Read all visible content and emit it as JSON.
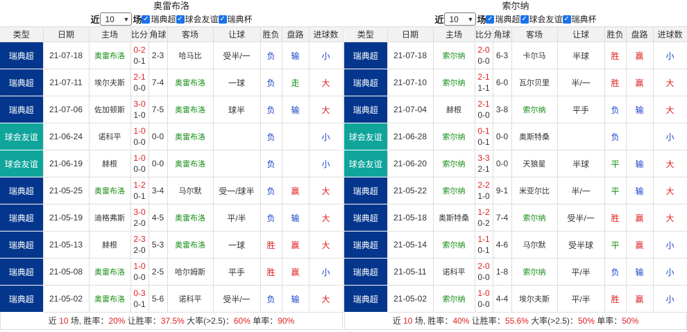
{
  "colors": {
    "league_bg": "#03368c",
    "cup_bg": "#0fa59b",
    "win": "#e02020",
    "home_team": "#138c13",
    "loss": "#1a42c9"
  },
  "panels": [
    {
      "title": "奥雷布洛",
      "filter": {
        "prefix": "近",
        "count": "10",
        "suffix": "场",
        "options": [
          "瑞典超",
          "球会友谊",
          "瑞典杯"
        ]
      },
      "headers": [
        "类型",
        "日期",
        "主场",
        "比分",
        "角球",
        "客场",
        "让球",
        "胜负",
        "盘路",
        "进球数"
      ],
      "rows": [
        {
          "type": "瑞典超",
          "cup": false,
          "date": "21-07-18",
          "home": "奥雷布洛",
          "home_hl": true,
          "score_ft": "0-2",
          "score_ht": "0-1",
          "corner": "2-3",
          "away": "哈马比",
          "away_hl": false,
          "handicap": "受半/一",
          "result": "负",
          "result_c": "blue",
          "pan": "输",
          "pan_c": "blue",
          "goals": "小",
          "goals_c": "blue"
        },
        {
          "type": "瑞典超",
          "cup": false,
          "date": "21-07-11",
          "home": "埃尔夫斯",
          "home_hl": false,
          "score_ft": "2-1",
          "score_ht": "0-0",
          "corner": "7-4",
          "away": "奥雷布洛",
          "away_hl": true,
          "handicap": "一球",
          "result": "负",
          "result_c": "blue",
          "pan": "走",
          "pan_c": "green",
          "goals": "大",
          "goals_c": "red"
        },
        {
          "type": "瑞典超",
          "cup": false,
          "date": "21-07-06",
          "home": "佐加顿斯",
          "home_hl": false,
          "score_ft": "3-0",
          "score_ht": "1-0",
          "corner": "7-5",
          "away": "奥雷布洛",
          "away_hl": true,
          "handicap": "球半",
          "result": "负",
          "result_c": "blue",
          "pan": "输",
          "pan_c": "blue",
          "goals": "大",
          "goals_c": "red"
        },
        {
          "type": "球会友谊",
          "cup": true,
          "date": "21-06-24",
          "home": "诺科平",
          "home_hl": false,
          "score_ft": "1-0",
          "score_ht": "0-0",
          "corner": "0-0",
          "away": "奥雷布洛",
          "away_hl": true,
          "handicap": "",
          "result": "负",
          "result_c": "blue",
          "pan": "",
          "pan_c": "blue",
          "goals": "小",
          "goals_c": "blue"
        },
        {
          "type": "球会友谊",
          "cup": true,
          "date": "21-06-19",
          "home": "赫根",
          "home_hl": false,
          "score_ft": "1-0",
          "score_ht": "0-0",
          "corner": "0-0",
          "away": "奥雷布洛",
          "away_hl": true,
          "handicap": "",
          "result": "负",
          "result_c": "blue",
          "pan": "",
          "pan_c": "blue",
          "goals": "小",
          "goals_c": "blue"
        },
        {
          "type": "瑞典超",
          "cup": false,
          "date": "21-05-25",
          "home": "奥雷布洛",
          "home_hl": true,
          "score_ft": "1-2",
          "score_ht": "0-1",
          "corner": "3-4",
          "away": "马尔默",
          "away_hl": false,
          "handicap": "受一/球半",
          "result": "负",
          "result_c": "blue",
          "pan": "赢",
          "pan_c": "red",
          "goals": "大",
          "goals_c": "red"
        },
        {
          "type": "瑞典超",
          "cup": false,
          "date": "21-05-19",
          "home": "迪格弗斯",
          "home_hl": false,
          "score_ft": "3-0",
          "score_ht": "2-0",
          "corner": "4-5",
          "away": "奥雷布洛",
          "away_hl": true,
          "handicap": "平/半",
          "result": "负",
          "result_c": "blue",
          "pan": "输",
          "pan_c": "blue",
          "goals": "大",
          "goals_c": "red"
        },
        {
          "type": "瑞典超",
          "cup": false,
          "date": "21-05-13",
          "home": "赫根",
          "home_hl": false,
          "score_ft": "2-3",
          "score_ht": "2-0",
          "corner": "5-3",
          "away": "奥雷布洛",
          "away_hl": true,
          "handicap": "一球",
          "result": "胜",
          "result_c": "red",
          "pan": "赢",
          "pan_c": "red",
          "goals": "大",
          "goals_c": "red"
        },
        {
          "type": "瑞典超",
          "cup": false,
          "date": "21-05-08",
          "home": "奥雷布洛",
          "home_hl": true,
          "score_ft": "1-0",
          "score_ht": "0-0",
          "corner": "2-5",
          "away": "哈尔姆斯",
          "away_hl": false,
          "handicap": "平手",
          "result": "胜",
          "result_c": "red",
          "pan": "赢",
          "pan_c": "red",
          "goals": "小",
          "goals_c": "blue"
        },
        {
          "type": "瑞典超",
          "cup": false,
          "date": "21-05-02",
          "home": "奥雷布洛",
          "home_hl": true,
          "score_ft": "0-3",
          "score_ht": "0-1",
          "corner": "5-6",
          "away": "诺科平",
          "away_hl": false,
          "handicap": "受半/一",
          "result": "负",
          "result_c": "blue",
          "pan": "输",
          "pan_c": "blue",
          "goals": "大",
          "goals_c": "red"
        }
      ],
      "summary": {
        "p1": "近 ",
        "n": "10",
        "p2": " 场, 胜率：",
        "win": "20%",
        "p3": " 让胜率：",
        "hwin": "37.5%",
        "p4": " 大率(>2.5)：",
        "big": "60%",
        "p5": " 单率：",
        "odd": "90%"
      }
    },
    {
      "title": "索尔纳",
      "filter": {
        "prefix": "近",
        "count": "10",
        "suffix": "场",
        "options": [
          "瑞典超",
          "球会友谊",
          "瑞典杯"
        ]
      },
      "headers": [
        "类型",
        "日期",
        "主场",
        "比分",
        "角球",
        "客场",
        "让球",
        "胜负",
        "盘路",
        "进球数"
      ],
      "rows": [
        {
          "type": "瑞典超",
          "cup": false,
          "date": "21-07-18",
          "home": "索尔纳",
          "home_hl": true,
          "score_ft": "2-0",
          "score_ht": "0-0",
          "corner": "6-3",
          "away": "卡尔马",
          "away_hl": false,
          "handicap": "半球",
          "result": "胜",
          "result_c": "red",
          "pan": "赢",
          "pan_c": "red",
          "goals": "小",
          "goals_c": "blue"
        },
        {
          "type": "瑞典超",
          "cup": false,
          "date": "21-07-10",
          "home": "索尔纳",
          "home_hl": true,
          "score_ft": "2-1",
          "score_ht": "1-1",
          "corner": "6-0",
          "away": "瓦尔贝里",
          "away_hl": false,
          "handicap": "半/一",
          "result": "胜",
          "result_c": "red",
          "pan": "赢",
          "pan_c": "red",
          "goals": "大",
          "goals_c": "red"
        },
        {
          "type": "瑞典超",
          "cup": false,
          "date": "21-07-04",
          "home": "赫根",
          "home_hl": false,
          "score_ft": "2-1",
          "score_ht": "0-0",
          "corner": "3-8",
          "away": "索尔纳",
          "away_hl": true,
          "handicap": "平手",
          "result": "负",
          "result_c": "blue",
          "pan": "输",
          "pan_c": "blue",
          "goals": "大",
          "goals_c": "red"
        },
        {
          "type": "球会友谊",
          "cup": true,
          "date": "21-06-28",
          "home": "索尔纳",
          "home_hl": true,
          "score_ft": "0-1",
          "score_ht": "0-1",
          "corner": "0-0",
          "away": "奥斯特桑",
          "away_hl": false,
          "handicap": "",
          "result": "负",
          "result_c": "blue",
          "pan": "",
          "pan_c": "blue",
          "goals": "小",
          "goals_c": "blue"
        },
        {
          "type": "球会友谊",
          "cup": true,
          "date": "21-06-20",
          "home": "索尔纳",
          "home_hl": true,
          "score_ft": "3-3",
          "score_ht": "2-1",
          "corner": "0-0",
          "away": "天狼星",
          "away_hl": false,
          "handicap": "半球",
          "result": "平",
          "result_c": "green",
          "pan": "输",
          "pan_c": "blue",
          "goals": "大",
          "goals_c": "red"
        },
        {
          "type": "瑞典超",
          "cup": false,
          "date": "21-05-22",
          "home": "索尔纳",
          "home_hl": true,
          "score_ft": "2-2",
          "score_ht": "1-0",
          "corner": "9-1",
          "away": "米亚尔比",
          "away_hl": false,
          "handicap": "半/一",
          "result": "平",
          "result_c": "green",
          "pan": "输",
          "pan_c": "blue",
          "goals": "大",
          "goals_c": "red"
        },
        {
          "type": "瑞典超",
          "cup": false,
          "date": "21-05-18",
          "home": "奥斯特桑",
          "home_hl": false,
          "score_ft": "1-2",
          "score_ht": "0-2",
          "corner": "7-4",
          "away": "索尔纳",
          "away_hl": true,
          "handicap": "受半/一",
          "result": "胜",
          "result_c": "red",
          "pan": "赢",
          "pan_c": "red",
          "goals": "大",
          "goals_c": "red"
        },
        {
          "type": "瑞典超",
          "cup": false,
          "date": "21-05-14",
          "home": "索尔纳",
          "home_hl": true,
          "score_ft": "1-1",
          "score_ht": "0-1",
          "corner": "4-6",
          "away": "马尔默",
          "away_hl": false,
          "handicap": "受半球",
          "result": "平",
          "result_c": "green",
          "pan": "赢",
          "pan_c": "red",
          "goals": "小",
          "goals_c": "blue"
        },
        {
          "type": "瑞典超",
          "cup": false,
          "date": "21-05-11",
          "home": "诺科平",
          "home_hl": false,
          "score_ft": "2-0",
          "score_ht": "0-0",
          "corner": "1-8",
          "away": "索尔纳",
          "away_hl": true,
          "handicap": "平/半",
          "result": "负",
          "result_c": "blue",
          "pan": "输",
          "pan_c": "blue",
          "goals": "小",
          "goals_c": "blue"
        },
        {
          "type": "瑞典超",
          "cup": false,
          "date": "21-05-02",
          "home": "索尔纳",
          "home_hl": true,
          "score_ft": "1-0",
          "score_ht": "0-0",
          "corner": "4-4",
          "away": "埃尔夫斯",
          "away_hl": false,
          "handicap": "平/半",
          "result": "胜",
          "result_c": "red",
          "pan": "赢",
          "pan_c": "red",
          "goals": "小",
          "goals_c": "blue"
        }
      ],
      "summary": {
        "p1": "近 ",
        "n": "10",
        "p2": " 场, 胜率：",
        "win": "40%",
        "p3": " 让胜率：",
        "hwin": "55.6%",
        "p4": " 大率(>2.5)：",
        "big": "50%",
        "p5": " 单率：",
        "odd": "50%"
      }
    }
  ]
}
